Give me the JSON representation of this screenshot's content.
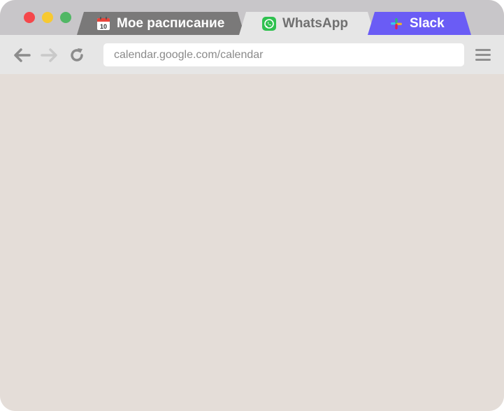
{
  "window": {
    "controls": {
      "close": "close-dot",
      "minimize": "minimize-dot",
      "maximize": "maximize-dot"
    },
    "colors": {
      "close": "#f5474b",
      "minimize": "#f7c931",
      "maximize": "#51b765",
      "content_background": "#e4ddd8"
    }
  },
  "tabs": [
    {
      "label": "Мое расписание",
      "icon": "calendar-icon",
      "calendar_day": "10",
      "color": "#7a7979"
    },
    {
      "label": "WhatsApp",
      "icon": "whatsapp-icon",
      "color": "#e6e6e6"
    },
    {
      "label": "Slack",
      "icon": "slack-icon",
      "color": "#6a5cf5"
    }
  ],
  "toolbar": {
    "back_icon": "arrow-left-icon",
    "forward_icon": "arrow-right-icon",
    "reload_icon": "reload-icon",
    "menu_icon": "hamburger-menu-icon",
    "url": "calendar.google.com/calendar"
  }
}
